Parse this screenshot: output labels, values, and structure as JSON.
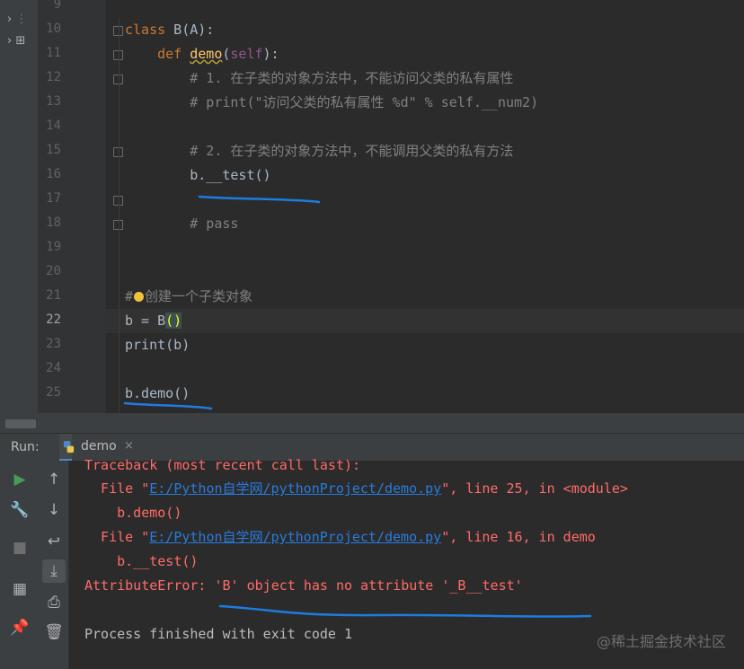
{
  "project": {
    "rows": [
      {
        "arrow": "›",
        "tag": "⋮"
      },
      {
        "arrow": "›",
        "tag": "⊞"
      }
    ]
  },
  "editor": {
    "line_numbers": [
      "9",
      "10",
      "11",
      "12",
      "13",
      "14",
      "15",
      "16",
      "17",
      "18",
      "19",
      "20",
      "21",
      "22",
      "23",
      "24",
      "25"
    ],
    "current_line": "22",
    "lines": {
      "l10_kw": "class",
      "l10_rest": " B(A):",
      "l11_indent": "    ",
      "l11_kw": "def",
      "l11_fn": "demo",
      "l11_p1": "(",
      "l11_self": "self",
      "l11_p2": "):",
      "l12": "        # 1. 在子类的对象方法中，不能访问父类的私有属性",
      "l13": "        # print(\"访问父类的私有属性 %d\" % self.__num2)",
      "l15": "        # 2. 在子类的对象方法中，不能调用父类的私有方法",
      "l16": "        b.__test()",
      "l18": "        # pass",
      "l21_a": "#",
      "l21_b": "创建一个子类对象",
      "l22_a": "b = B",
      "l22_b": "()",
      "l23": "print(b)",
      "l25": "b.demo()"
    }
  },
  "run": {
    "label": "Run:",
    "tab_name": "demo",
    "tab_close": "×",
    "tools_left": [
      {
        "icon": "play-icon",
        "glyph": "▶"
      },
      {
        "icon": "wrench-icon",
        "glyph": "🔧"
      },
      {
        "icon": "stop-icon",
        "glyph": "■"
      },
      {
        "icon": "layout-icon",
        "glyph": "▦"
      },
      {
        "icon": "pin-icon",
        "glyph": "📌"
      }
    ],
    "tools_right": [
      {
        "icon": "arrow-up-icon",
        "glyph": "↑"
      },
      {
        "icon": "arrow-down-icon",
        "glyph": "↓"
      },
      {
        "icon": "soft-wrap-icon",
        "glyph": "↩"
      },
      {
        "icon": "scroll-to-end-icon",
        "glyph": "⤓"
      },
      {
        "icon": "print-icon",
        "glyph": "⎙"
      },
      {
        "icon": "trash-icon",
        "glyph": "🗑"
      }
    ]
  },
  "console": {
    "traceback": "Traceback (most recent call last):",
    "f1_pre": "  File \"",
    "f1_link": "E:/Python自学网/pythonProject/demo.py",
    "f1_post": "\", line 25, in <module>",
    "f1_code": "    b.demo()",
    "f2_pre": "  File \"",
    "f2_link": "E:/Python自学网/pythonProject/demo.py",
    "f2_post": "\", line 16, in demo",
    "f2_code": "    b.__test()",
    "error": "AttributeError: 'B' object has no attribute '_B__test'",
    "exit": "Process finished with exit code 1"
  },
  "watermark": "@稀土掘金技术社区",
  "colors": {
    "background": "#2b2b2b",
    "keyword": "#cc7832",
    "error": "#ff6b68",
    "link": "#287bde",
    "annotation_ink": "#1e7be0"
  }
}
